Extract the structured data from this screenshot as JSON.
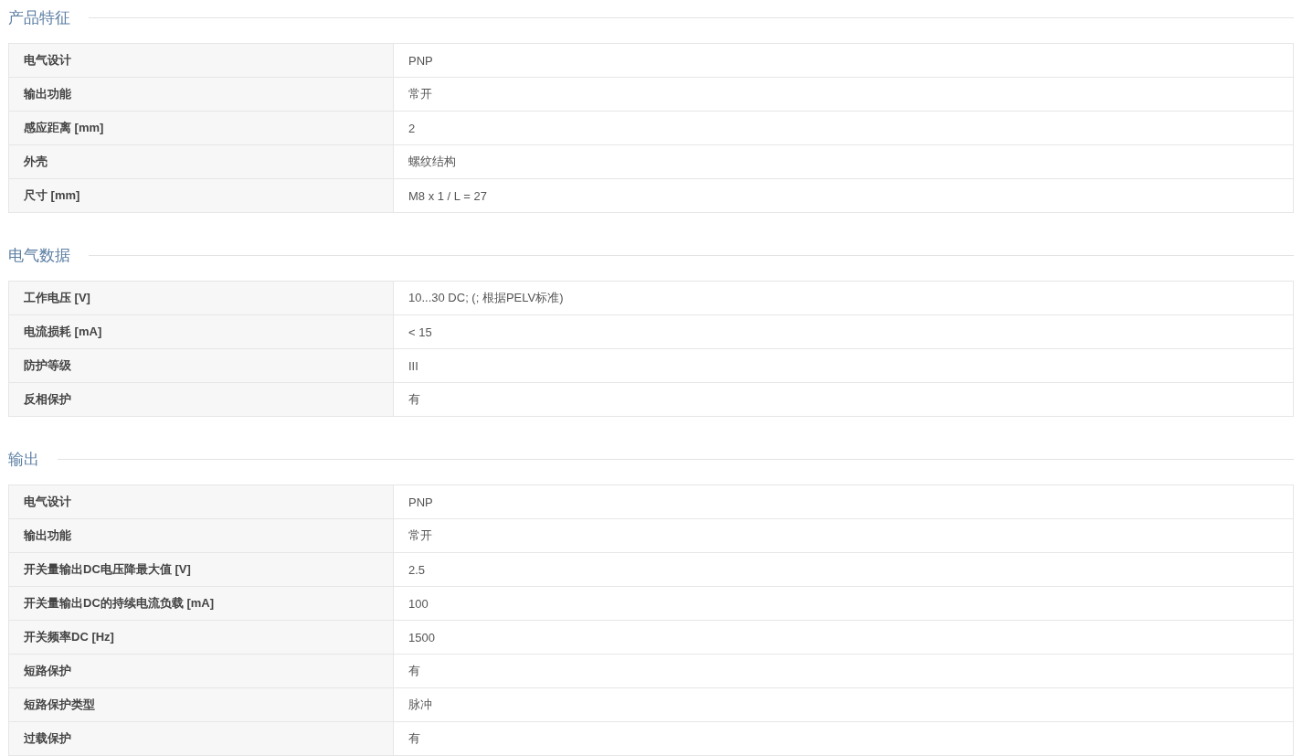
{
  "sections": [
    {
      "title": "产品特征",
      "rows": [
        {
          "label": "电气设计",
          "value": "PNP"
        },
        {
          "label": "输出功能",
          "value": "常开"
        },
        {
          "label": "感应距离 [mm]",
          "value": "2"
        },
        {
          "label": "外壳",
          "value": "螺纹结构"
        },
        {
          "label": "尺寸 [mm]",
          "value": "M8 x 1 / L = 27"
        }
      ]
    },
    {
      "title": "电气数据",
      "rows": [
        {
          "label": "工作电压 [V]",
          "value": "10...30 DC; (; 根据PELV标准)"
        },
        {
          "label": "电流损耗 [mA]",
          "value": "< 15"
        },
        {
          "label": "防护等级",
          "value": "III"
        },
        {
          "label": "反相保护",
          "value": "有"
        }
      ]
    },
    {
      "title": "输出",
      "rows": [
        {
          "label": "电气设计",
          "value": "PNP"
        },
        {
          "label": "输出功能",
          "value": "常开"
        },
        {
          "label": "开关量输出DC电压降最大值 [V]",
          "value": "2.5"
        },
        {
          "label": "开关量输出DC的持续电流负载 [mA]",
          "value": "100"
        },
        {
          "label": "开关频率DC [Hz]",
          "value": "1500"
        },
        {
          "label": "短路保护",
          "value": "有"
        },
        {
          "label": "短路保护类型",
          "value": "脉冲"
        },
        {
          "label": "过载保护",
          "value": "有"
        }
      ]
    }
  ]
}
